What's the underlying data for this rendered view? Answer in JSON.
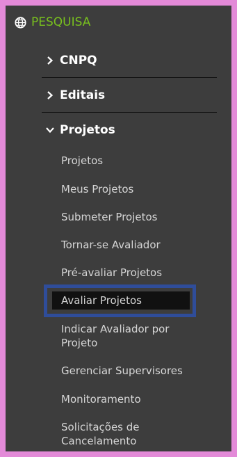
{
  "section": {
    "icon": "globe-icon",
    "label": "PESQUISA"
  },
  "groups": [
    {
      "label": "CNPQ",
      "icon": "chevron-right-icon"
    },
    {
      "label": "Editais",
      "icon": "chevron-right-icon"
    },
    {
      "label": "Projetos",
      "icon": "chevron-down-icon"
    }
  ],
  "project_items": [
    "Projetos",
    "Meus Projetos",
    "Submeter Projetos",
    "Tornar-se Avaliador",
    "Pré-avaliar Projetos",
    "Avaliar Projetos",
    "Indicar Avaliador por Projeto",
    "Gerenciar Supervisores",
    "Monitoramento",
    "Solicitações de Cancelamento"
  ],
  "colors": {
    "frame": "#e38ad8",
    "panel": "#3d3d3d",
    "section": "#79c11e",
    "highlight": "#2f4d9a"
  }
}
